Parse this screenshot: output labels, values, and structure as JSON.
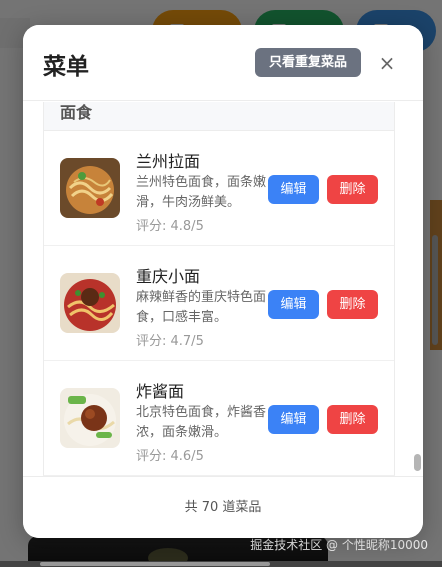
{
  "modal": {
    "title": "菜单",
    "filter_button": "只看重复菜品",
    "close_icon": "×"
  },
  "category": {
    "name": "面食"
  },
  "dishes": [
    {
      "name": "兰州拉面",
      "description": "兰州特色面食，面条嫩滑，牛肉汤鲜美。",
      "rating": "评分: 4.8/5",
      "edit_label": "编辑",
      "delete_label": "删除"
    },
    {
      "name": "重庆小面",
      "description": "麻辣鲜香的重庆特色面食，口感丰富。",
      "rating": "评分: 4.7/5",
      "edit_label": "编辑",
      "delete_label": "删除"
    },
    {
      "name": "炸酱面",
      "description": "北京特色面食，炸酱香浓，面条嫩滑。",
      "rating": "评分: 4.6/5",
      "edit_label": "编辑",
      "delete_label": "删除"
    }
  ],
  "footer": {
    "count_text": "共 70 道菜品"
  },
  "watermark": "掘金技术社区 @ 个性昵称10000",
  "colors": {
    "edit": "#3b82f6",
    "delete": "#ef4444",
    "filter": "#6b7280"
  }
}
